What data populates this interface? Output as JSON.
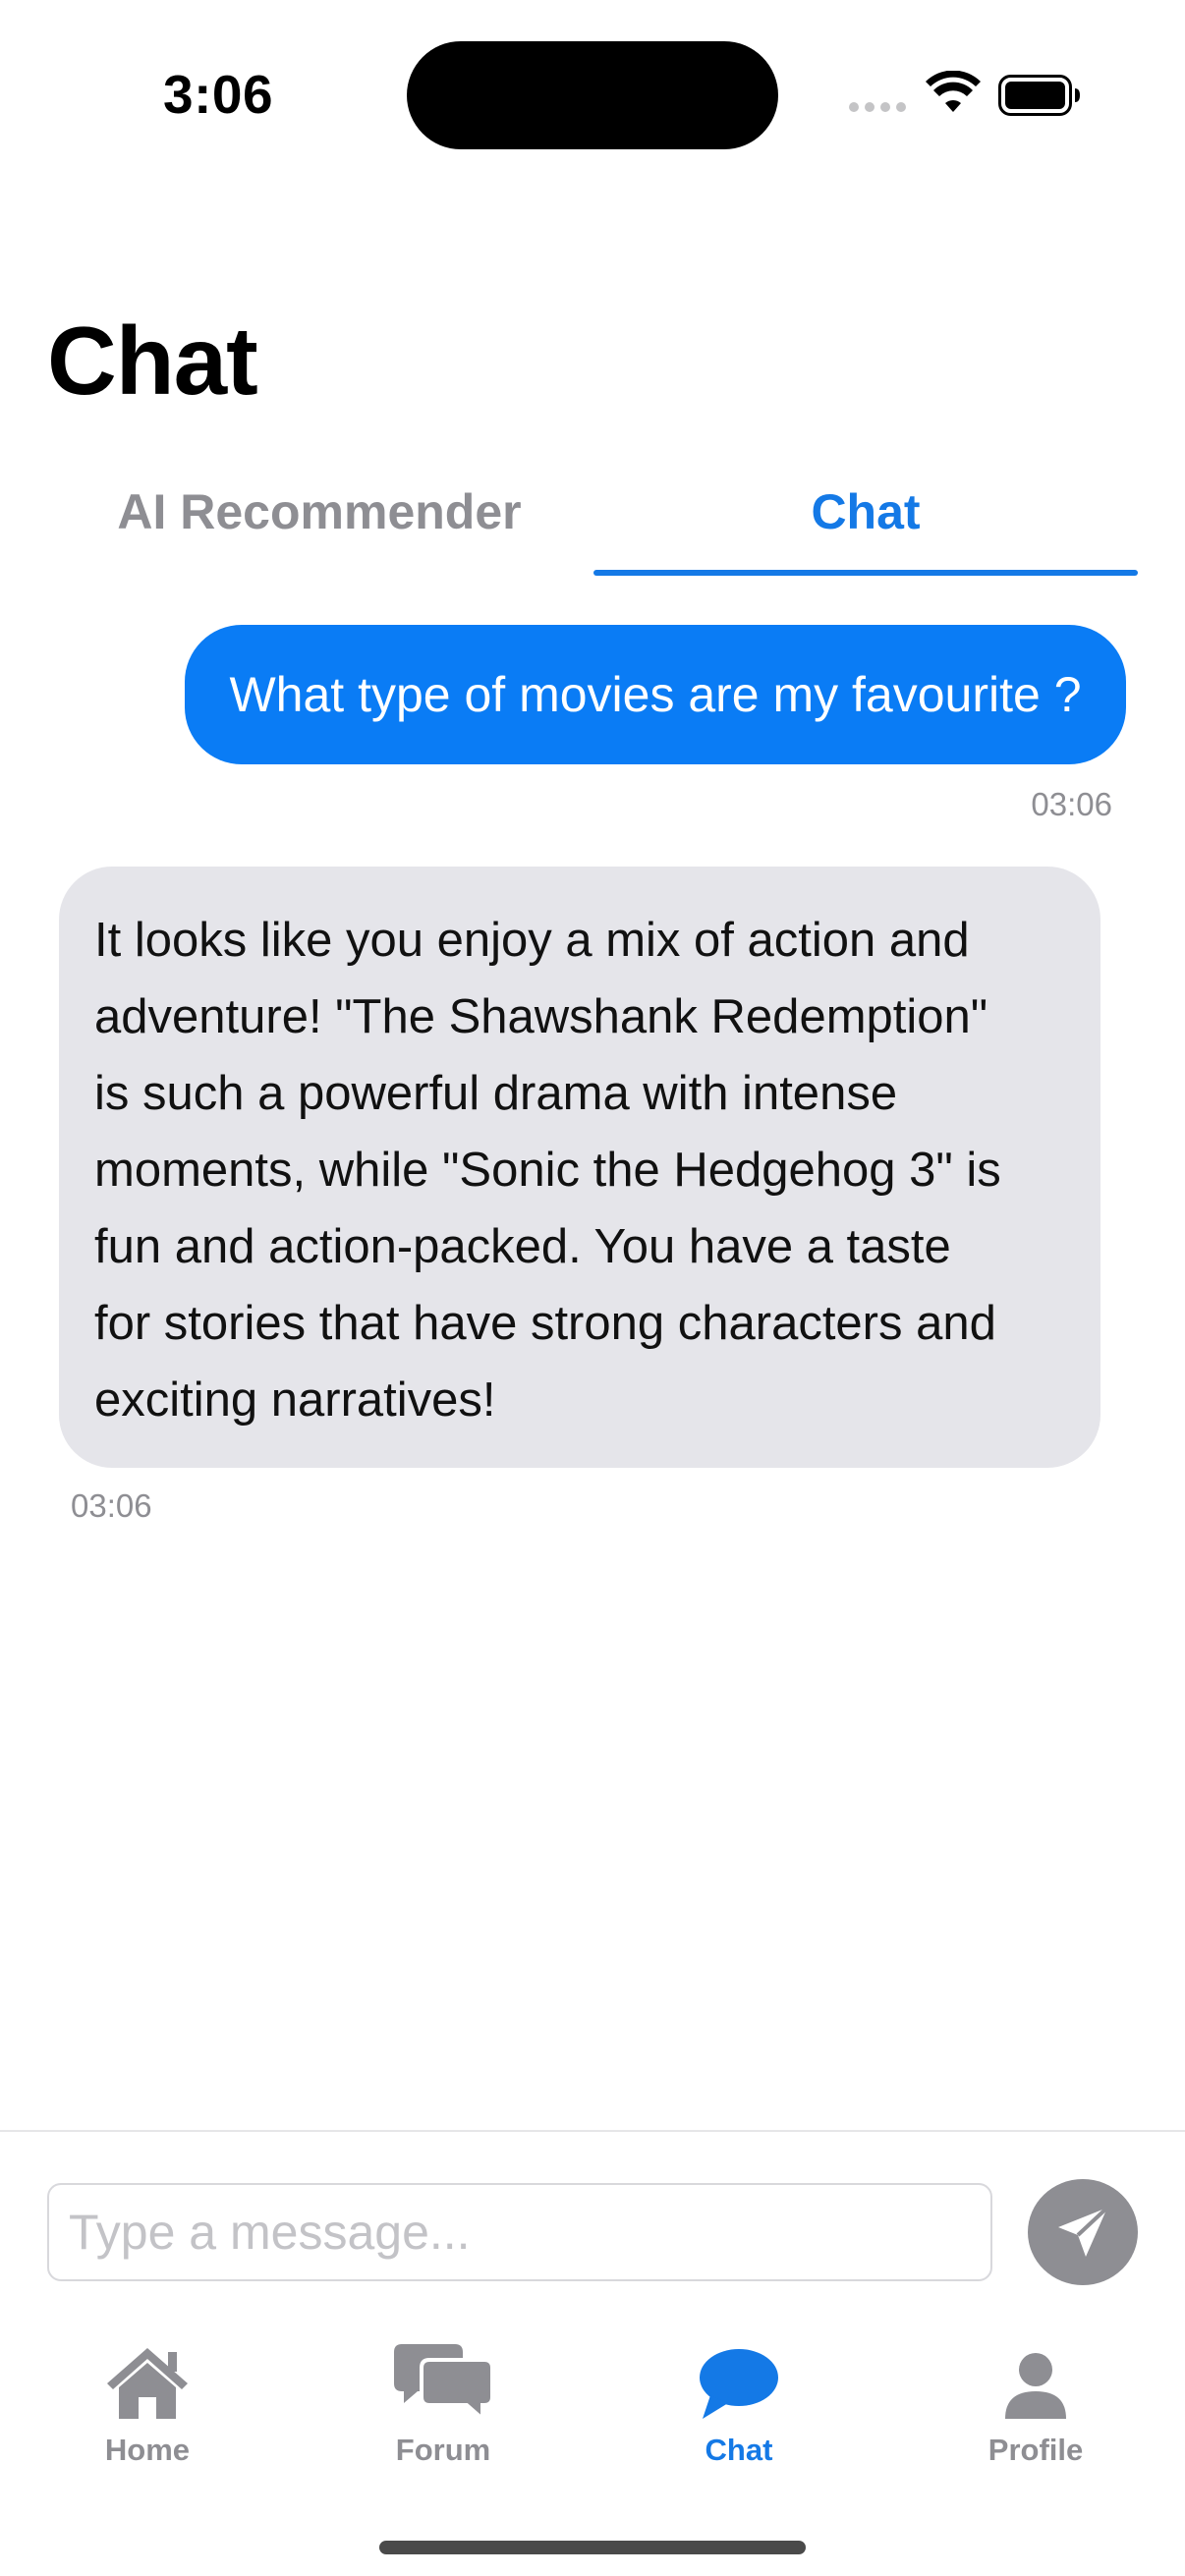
{
  "status_bar": {
    "time": "3:06"
  },
  "page": {
    "title": "Chat"
  },
  "tabs": [
    {
      "label": "AI Recommender",
      "selected": false
    },
    {
      "label": "Chat",
      "selected": true
    }
  ],
  "messages": [
    {
      "sender": "user",
      "text": "What type of movies are my favourite ?",
      "time": "03:06"
    },
    {
      "sender": "assistant",
      "lines": [
        "It looks like you enjoy a mix of action and",
        "adventure! \"The Shawshank Redemption\"",
        "is such a powerful drama with intense",
        "moments, while \"Sonic the Hedgehog 3\" is",
        "fun and action-packed. You have a taste",
        "for stories that have strong characters and",
        "exciting narratives!"
      ],
      "time": "03:06"
    }
  ],
  "composer": {
    "placeholder": "Type a message...",
    "value": "",
    "send_icon": "paper-plane-icon"
  },
  "tab_bar": [
    {
      "label": "Home",
      "icon": "house-icon",
      "active": false
    },
    {
      "label": "Forum",
      "icon": "speech-bubbles-icon",
      "active": false
    },
    {
      "label": "Chat",
      "icon": "chat-bubble-icon",
      "active": true
    },
    {
      "label": "Profile",
      "icon": "person-icon",
      "active": false
    }
  ],
  "colors": {
    "accent": "#1479e6",
    "outgoing_bubble": "#0a7cf5",
    "incoming_bubble": "#e5e5ea",
    "inactive": "#8e8e93"
  }
}
